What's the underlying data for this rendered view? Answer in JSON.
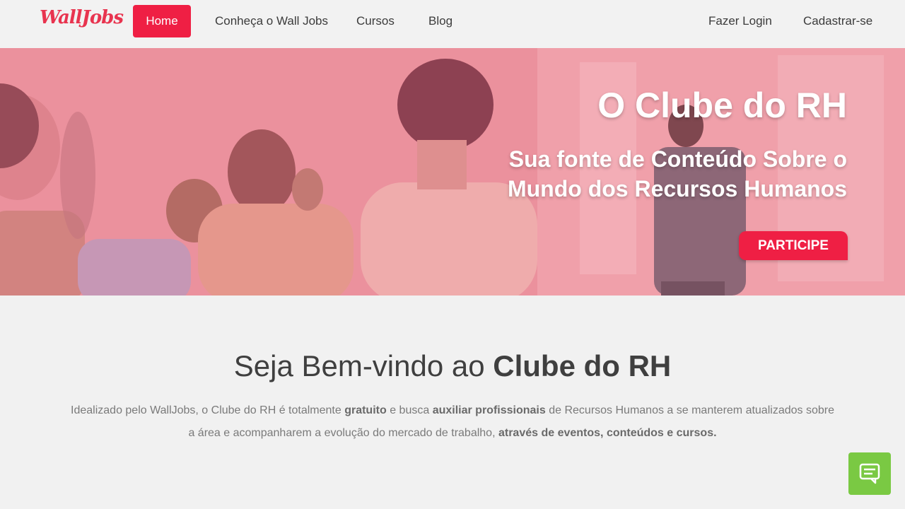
{
  "header": {
    "logo_text": "WallJobs",
    "nav": {
      "home": "Home",
      "about": "Conheça o Wall Jobs",
      "cursos": "Cursos",
      "blog": "Blog",
      "login": "Fazer Login",
      "signup": "Cadastrar-se"
    }
  },
  "hero": {
    "title": "O Clube do RH",
    "subtitle": "Sua fonte de Conteúdo Sobre o Mundo dos Recursos Humanos",
    "cta": "PARTICIPE"
  },
  "welcome": {
    "title_prefix": "Seja Bem-vindo ao",
    "title_bold": "Clube do RH",
    "text_1": "Idealizado pelo WallJobs, o Clube do RH é totalmente",
    "text_bold_1": "gratuito",
    "text_2": "e busca",
    "text_bold_2": "auxiliar profissionais",
    "text_3": "de Recursos Humanos a se manterem atualizados sobre a área e acompanharem a evolução do mercado de trabalho,",
    "text_bold_3": "através de eventos, conteúdos e cursos."
  },
  "chat": {
    "icon": "chat-icon"
  },
  "colors": {
    "accent": "#ef1f44",
    "chat": "#7ac943",
    "hero_overlay": "#ec9fa8"
  }
}
